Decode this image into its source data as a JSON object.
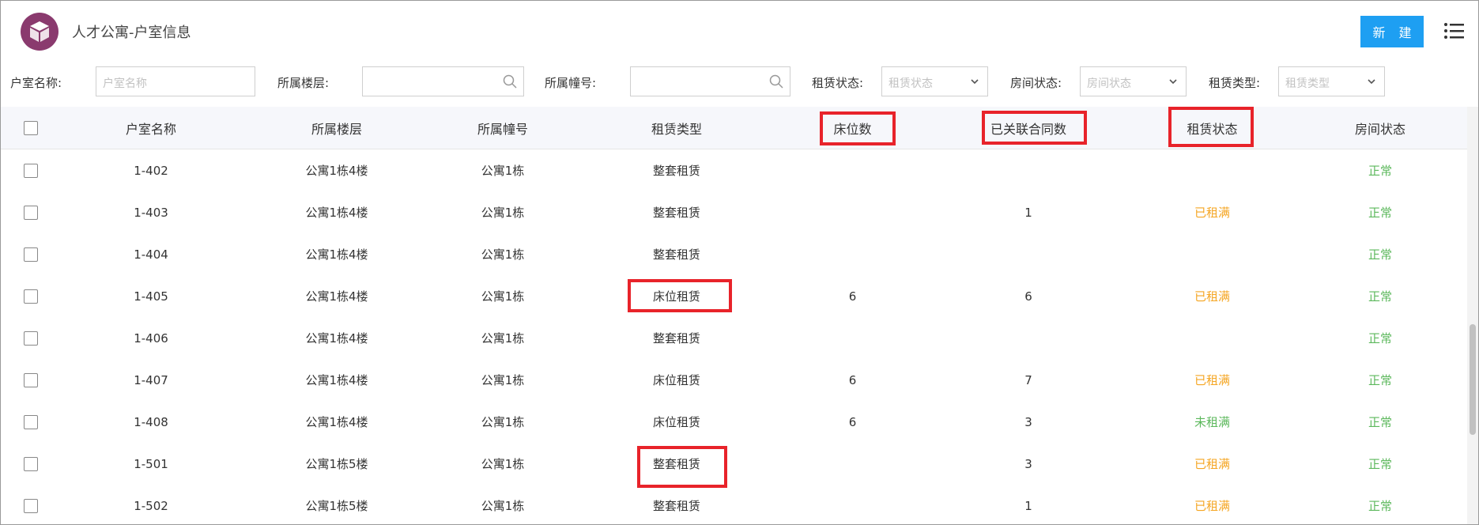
{
  "header": {
    "title": "人才公寓-户室信息",
    "new_button": "新 建",
    "logo_icon": "cube-icon",
    "menu_icon": "list-menu-icon",
    "accent_color": "#1e9ff2"
  },
  "filters": {
    "room_name": {
      "label": "户室名称:",
      "placeholder": "户室名称"
    },
    "floor": {
      "label": "所属楼层:",
      "placeholder": ""
    },
    "building": {
      "label": "所属幢号:",
      "placeholder": ""
    },
    "rent_status": {
      "label": "租赁状态:",
      "placeholder": "租赁状态"
    },
    "room_status": {
      "label": "房间状态:",
      "placeholder": "房间状态"
    },
    "rent_type": {
      "label": "租赁类型:",
      "placeholder": "租赁类型"
    }
  },
  "table": {
    "columns": [
      "户室名称",
      "所属楼层",
      "所属幢号",
      "租赁类型",
      "床位数",
      "已关联合同数",
      "租赁状态",
      "房间状态"
    ],
    "rows": [
      {
        "name": "1-402",
        "floor": "公寓1栋4楼",
        "building": "公寓1栋",
        "type": "整套租赁",
        "beds": "",
        "contracts": "",
        "rent_status": "",
        "room_status": "正常"
      },
      {
        "name": "1-403",
        "floor": "公寓1栋4楼",
        "building": "公寓1栋",
        "type": "整套租赁",
        "beds": "",
        "contracts": "1",
        "rent_status": "已租满",
        "room_status": "正常"
      },
      {
        "name": "1-404",
        "floor": "公寓1栋4楼",
        "building": "公寓1栋",
        "type": "整套租赁",
        "beds": "",
        "contracts": "",
        "rent_status": "",
        "room_status": "正常"
      },
      {
        "name": "1-405",
        "floor": "公寓1栋4楼",
        "building": "公寓1栋",
        "type": "床位租赁",
        "beds": "6",
        "contracts": "6",
        "rent_status": "已租满",
        "room_status": "正常"
      },
      {
        "name": "1-406",
        "floor": "公寓1栋4楼",
        "building": "公寓1栋",
        "type": "整套租赁",
        "beds": "",
        "contracts": "",
        "rent_status": "",
        "room_status": "正常"
      },
      {
        "name": "1-407",
        "floor": "公寓1栋4楼",
        "building": "公寓1栋",
        "type": "床位租赁",
        "beds": "6",
        "contracts": "7",
        "rent_status": "已租满",
        "room_status": "正常"
      },
      {
        "name": "1-408",
        "floor": "公寓1栋4楼",
        "building": "公寓1栋",
        "type": "床位租赁",
        "beds": "6",
        "contracts": "3",
        "rent_status": "未租满",
        "room_status": "正常"
      },
      {
        "name": "1-501",
        "floor": "公寓1栋5楼",
        "building": "公寓1栋",
        "type": "整套租赁",
        "beds": "",
        "contracts": "3",
        "rent_status": "已租满",
        "room_status": "正常"
      },
      {
        "name": "1-502",
        "floor": "公寓1栋5楼",
        "building": "公寓1栋",
        "type": "整套租赁",
        "beds": "",
        "contracts": "1",
        "rent_status": "已租满",
        "room_status": "正常"
      }
    ]
  },
  "status_colors": {
    "已租满": "#f5a623",
    "未租满": "#5cb85c",
    "正常": "#5cb85c"
  }
}
